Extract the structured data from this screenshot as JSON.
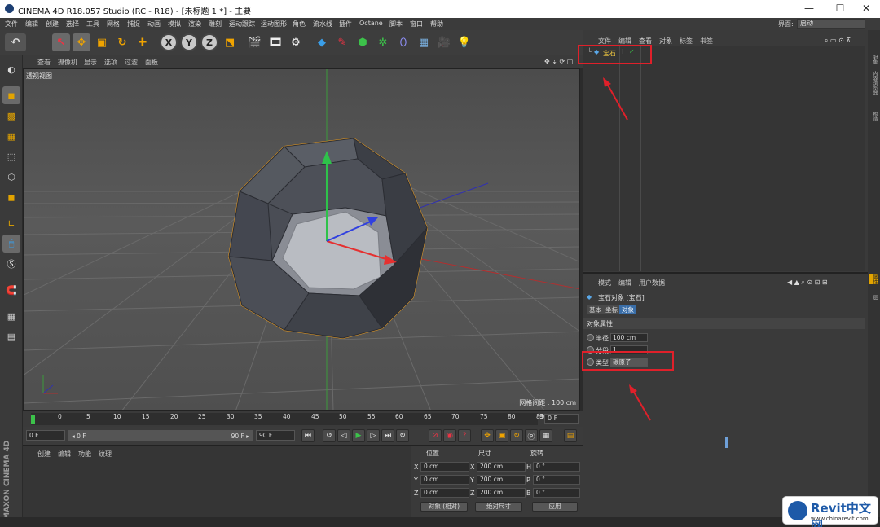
{
  "window": {
    "title": "CINEMA 4D R18.057 Studio (RC - R18) - [未标题 1 *] - 主要",
    "min": "—",
    "max": "☐",
    "close": "✕"
  },
  "menu": [
    "文件",
    "编辑",
    "创建",
    "选择",
    "工具",
    "网格",
    "捕捉",
    "动画",
    "模拟",
    "渲染",
    "雕刻",
    "运动跟踪",
    "运动图形",
    "角色",
    "流水线",
    "插件",
    "Octane",
    "脚本",
    "窗口",
    "帮助"
  ],
  "interface": {
    "label": "界面:",
    "value": "启动"
  },
  "viewport_menu": [
    "查看",
    "摄像机",
    "显示",
    "选项",
    "过滤",
    "面板"
  ],
  "viewport": {
    "label": "透视视图",
    "grid_spacing": "网格间距 : 100 cm"
  },
  "timeline": {
    "ticks": [
      "0",
      "5",
      "10",
      "15",
      "20",
      "25",
      "30",
      "35",
      "40",
      "45",
      "50",
      "55",
      "60",
      "65",
      "70",
      "75",
      "80",
      "85",
      "90"
    ],
    "current": "0 F"
  },
  "transport": {
    "start": "0 F",
    "start2": "◂ 0 F",
    "end": "90 F ▸",
    "end2": "90 F"
  },
  "material_menu": [
    "创建",
    "编辑",
    "功能",
    "纹理"
  ],
  "coords": {
    "headers": [
      "位置",
      "尺寸",
      "旋转"
    ],
    "rows": [
      {
        "axis": "X",
        "pos": "0 cm",
        "size_axis": "X",
        "size": "200 cm",
        "rot_axis": "H",
        "rot": "0 °"
      },
      {
        "axis": "Y",
        "pos": "0 cm",
        "size_axis": "Y",
        "size": "200 cm",
        "rot_axis": "P",
        "rot": "0 °"
      },
      {
        "axis": "Z",
        "pos": "0 cm",
        "size_axis": "Z",
        "size": "200 cm",
        "rot_axis": "B",
        "rot": "0 °"
      }
    ],
    "mode": "对象 (相对)",
    "size_mode": "绝对尺寸",
    "apply": "应用"
  },
  "object_manager": {
    "menu": [
      "文件",
      "编辑",
      "查看",
      "对象",
      "标签",
      "书签"
    ],
    "object_name": "宝石"
  },
  "attribute_manager": {
    "menu": [
      "模式",
      "编辑",
      "用户数据"
    ],
    "title": "宝石对象 [宝石]",
    "tabs": [
      "基本",
      "坐标",
      "对象"
    ],
    "section": "对象属性",
    "props": [
      {
        "label": "半径",
        "value": "100 cm"
      },
      {
        "label": "分段",
        "value": "1"
      },
      {
        "label": "类型",
        "value": "碳原子"
      }
    ]
  },
  "right_tabs": [
    "对象",
    "内容浏览器",
    "构造",
    "属性",
    "层"
  ],
  "watermark": {
    "brand": "Revit中文网",
    "url": "www.chinarevit.com"
  },
  "logo_text": "MAXON CINEMA 4D"
}
